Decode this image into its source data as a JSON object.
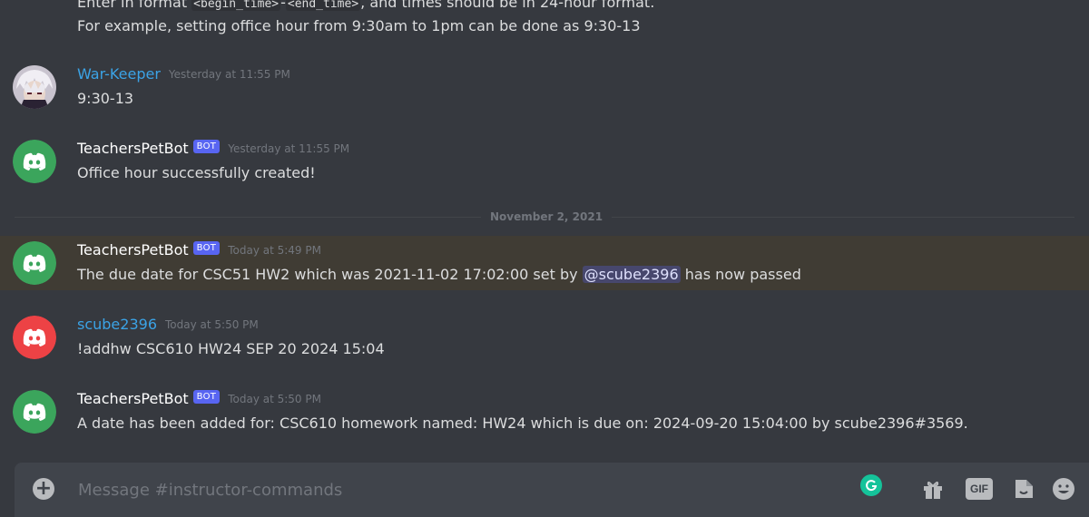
{
  "intro": {
    "line1_prefix": "Enter in format ",
    "line1_code1": "<begin_time>",
    "line1_dash": "-",
    "line1_code2": "<end_time>",
    "line1_suffix": ", and times should be in 24-hour format.",
    "line2": "For example, setting office hour from 9:30am to 1pm can be done as 9:30-13"
  },
  "messages": [
    {
      "author": "War-Keeper",
      "timestamp": "Yesterday at 11:55 PM",
      "content": "9:30-13"
    },
    {
      "author": "TeachersPetBot",
      "bot_tag": "BOT",
      "timestamp": "Yesterday at 11:55 PM",
      "content": "Office hour successfully created!"
    },
    {
      "author": "TeachersPetBot",
      "bot_tag": "BOT",
      "timestamp": "Today at 5:49 PM",
      "content_prefix": "The due date for CSC51 HW2 which was 2021-11-02 17:02:00 set by ",
      "mention": "@scube2396",
      "content_suffix": " has now passed"
    },
    {
      "author": "scube2396",
      "timestamp": "Today at 5:50 PM",
      "content": "!addhw CSC610 HW24 SEP 20 2024 15:04"
    },
    {
      "author": "TeachersPetBot",
      "bot_tag": "BOT",
      "timestamp": "Today at 5:50 PM",
      "content": "A date has been added for: CSC610 homework named: HW24 which is due on: 2024-09-20 15:04:00 by scube2396#3569."
    }
  ],
  "divider": {
    "date": "November 2, 2021"
  },
  "composer": {
    "placeholder": "Message #instructor-commands",
    "gif_label": "GIF",
    "icons": [
      "plus-icon",
      "grammarly-icon",
      "gift-icon",
      "gif-icon",
      "sticker-icon",
      "emoji-icon"
    ]
  },
  "colors": {
    "background": "#36393f",
    "user_name": "#3ba3e6",
    "bot_tag": "#5865f2",
    "highlight": "#403c34",
    "discord_green": "#3ba55c",
    "discord_red": "#ed4245"
  }
}
